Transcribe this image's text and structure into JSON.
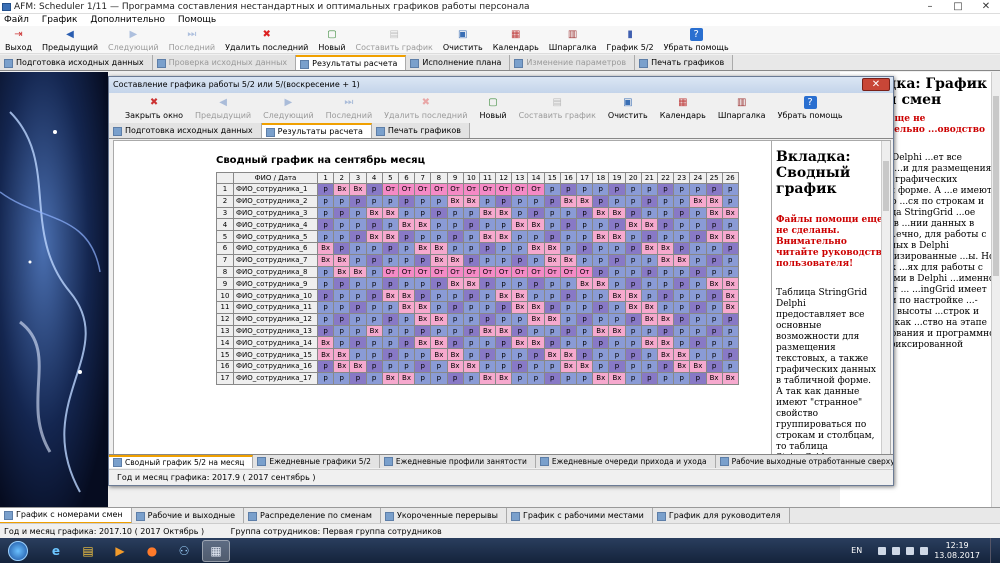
{
  "app": {
    "title": "AFM: Scheduler 1/11 — Программа составления  нестандартных и оптимальных графиков работы персонала",
    "win_controls": [
      "–",
      "□",
      "✕"
    ]
  },
  "menu": [
    "Файл",
    "График",
    "Дополнительно",
    "Помощь"
  ],
  "toolbar": [
    {
      "label": "Выход",
      "icon": "exit-icon",
      "enabled": true
    },
    {
      "label": "Предыдущий",
      "icon": "prev-icon",
      "enabled": true
    },
    {
      "label": "Следующий",
      "icon": "next-icon",
      "enabled": false
    },
    {
      "label": "Последний",
      "icon": "last-icon",
      "enabled": false
    },
    {
      "label": "Удалить последний",
      "icon": "delete-icon",
      "enabled": true
    },
    {
      "label": "Новый",
      "icon": "new-icon",
      "enabled": true
    },
    {
      "label": "Составить график",
      "icon": "compose-icon",
      "enabled": false
    },
    {
      "label": "Очистить",
      "icon": "clear-icon",
      "enabled": true
    },
    {
      "label": "Календарь",
      "icon": "calendar-icon",
      "enabled": true
    },
    {
      "label": "Шпаргалка",
      "icon": "cheatsheet-icon",
      "enabled": true
    },
    {
      "label": "График 5/2",
      "icon": "chart-icon",
      "enabled": true
    },
    {
      "label": "Убрать помощь",
      "icon": "help-icon",
      "enabled": true
    }
  ],
  "main_tabs": [
    {
      "label": "Подготовка исходных данных",
      "active": false,
      "enabled": true
    },
    {
      "label": "Проверка исходных данных",
      "active": false,
      "enabled": false
    },
    {
      "label": "Результаты расчета",
      "active": true,
      "enabled": true
    },
    {
      "label": "Исполнение плана",
      "active": false,
      "enabled": true
    },
    {
      "label": "Изменение параметров",
      "active": false,
      "enabled": false
    },
    {
      "label": "Печать графиков",
      "active": false,
      "enabled": true
    }
  ],
  "dialog": {
    "title": "Составление графика работы 5/2 или 5/(воскресение + 1)",
    "close": "✕",
    "toolbar": [
      {
        "label": "Закрыть окно",
        "icon": "close-window-icon",
        "enabled": true
      },
      {
        "label": "Предыдущий",
        "icon": "prev-icon",
        "enabled": false
      },
      {
        "label": "Следующий",
        "icon": "next-icon",
        "enabled": false
      },
      {
        "label": "Последний",
        "icon": "last-icon",
        "enabled": false
      },
      {
        "label": "Удалить последний",
        "icon": "delete-icon",
        "enabled": false
      },
      {
        "label": "Новый",
        "icon": "new-icon",
        "enabled": true
      },
      {
        "label": "Составить график",
        "icon": "compose-icon",
        "enabled": false
      },
      {
        "label": "Очистить",
        "icon": "clear-icon",
        "enabled": true
      },
      {
        "label": "Календарь",
        "icon": "calendar-icon",
        "enabled": true
      },
      {
        "label": "Шпаргалка",
        "icon": "cheatsheet-icon",
        "enabled": true
      },
      {
        "label": "Убрать помощь",
        "icon": "help-icon",
        "enabled": true
      }
    ],
    "tabs": [
      {
        "label": "Подготовка исходных данных",
        "active": false
      },
      {
        "label": "Результаты расчета",
        "active": true
      },
      {
        "label": "Печать графиков",
        "active": false
      }
    ],
    "heading": "Сводный график на сентябрь месяц",
    "grid_header_name": "ФИО / Дата",
    "days": [
      "1",
      "2",
      "3",
      "4",
      "5",
      "6",
      "7",
      "8",
      "9",
      "10",
      "11",
      "12",
      "13",
      "14",
      "15",
      "16",
      "17",
      "18",
      "19",
      "20",
      "21",
      "22",
      "23",
      "24",
      "25",
      "26"
    ],
    "rows": [
      {
        "n": "1",
        "name": "ФИО_сотрудника_1",
        "cells": "р Вх Вх р От От От От От От От От От От р р р р р р р р р р р р"
      },
      {
        "n": "2",
        "name": "ФИО_сотрудника_2",
        "cells": "р р р р р р р р Вх Вх р р р р р Вх Вх р р р р р р Вх Вх р"
      },
      {
        "n": "3",
        "name": "ФИО_сотрудника_3",
        "cells": "р р р Вх Вх р р р р р Вх Вх р р р р р Вх Вх р р р р р Вх Вх"
      },
      {
        "n": "4",
        "name": "ФИО_сотрудника_4",
        "cells": "р р р р р Вх Вх р р р р р Вх Вх р р р р р Вх Вх р р р р р"
      },
      {
        "n": "5",
        "name": "ФИО_сотрудника_5",
        "cells": "р р р Вх Вх р р р р р Вх Вх р р р р р Вх Вх р р р р р Вх Вх"
      },
      {
        "n": "6",
        "name": "ФИО_сотрудника_6",
        "cells": "Вх р р р р р Вх Вх р р р р р Вх Вх р р р р р Вх Вх р р р р"
      },
      {
        "n": "7",
        "name": "ФИО_сотрудника_7",
        "cells": "Вх Вх р р р р р Вх Вх р р р р р Вх Вх р р р р р Вх Вх р р р"
      },
      {
        "n": "8",
        "name": "ФИО_сотрудника_8",
        "cells": "р Вх Вх р От От От От От От От От От От От От От р р р р р р р р р"
      },
      {
        "n": "9",
        "name": "ФИО_сотрудника_9",
        "cells": "р р р р р р р р Вх Вх р р р р р р Вх Вх р р р р р р Вх Вх"
      },
      {
        "n": "10",
        "name": "ФИО_сотрудника_10",
        "cells": "р р р р Вх Вх р р р р р Вх Вх р р р р р Вх Вх р р р р р Вх"
      },
      {
        "n": "11",
        "name": "ФИО_сотрудника_11",
        "cells": "р р р р р Вх Вх р р р р р Вх Вх р р р р р Вх Вх р р р р Вх"
      },
      {
        "n": "12",
        "name": "ФИО_сотрудника_12",
        "cells": "р р р р р р Вх Вх р р р р р Вх Вх р р р р р Вх Вх р р р р"
      },
      {
        "n": "13",
        "name": "ФИО_сотрудника_13",
        "cells": "р р р Вх р р р р р р Вх Вх р р р р р Вх Вх р р р р р р р"
      },
      {
        "n": "14",
        "name": "ФИО_сотрудника_14",
        "cells": "Вх р р р р р Вх Вх р р р р Вх Вх р р р р р р Вх Вх р р р р"
      },
      {
        "n": "15",
        "name": "ФИО_сотрудника_15",
        "cells": "Вх Вх р р р р р Вх Вх р р р р р Вх Вх р р р р р Вх Вх р р р"
      },
      {
        "n": "16",
        "name": "ФИО_сотрудника_16",
        "cells": "р Вх Вх р р р р р Вх Вх р р р р р Вх Вх р р р р р Вх Вх р р"
      },
      {
        "n": "17",
        "name": "ФИО_сотрудника_17",
        "cells": "р р р р Вх Вх р р р р Вх Вх р р р р р Вх Вх р р р р р Вх Вх"
      }
    ],
    "help_heading": "Вкладка: Сводный график",
    "help_warning": "Файлы помощи еще не сделаны. Внимательно читайте руководство пользователя!",
    "help_body": "Таблица StringGrid Delphi предоставляет все основные возможности для размещения текстовых, а также графических данных в табличной форме. А так как данные имеют \"странное\" свойство группироваться по строкам и столбцам, то таблица StringGrid имеет важное значение",
    "bottom_tabs": [
      {
        "label": "Сводный график 5/2 на месяц",
        "active": true
      },
      {
        "label": "Ежедневные графики 5/2",
        "active": false
      },
      {
        "label": "Ежедневные профили занятости",
        "active": false
      },
      {
        "label": "Ежедневные очереди прихода и ухода",
        "active": false
      },
      {
        "label": "Рабочие выходные отработанные сверхурочные",
        "active": false
      }
    ],
    "status": "Год и месяц графика:  2017.9  ( 2017  сентябрь )"
  },
  "right_panel": {
    "heading": "Вкладка: График с ...ми смен",
    "warning": "...мощи еще не ...внимательно ...оводство ...ля!",
    "body": "...ingGrid Delphi ...ет все основные ...и для размещения ...а также графических ...бличной форме. А ...е имеют ...свойство ...ся по строкам и ...о таблица StringGrid ...ое значение в ...нии данных в системе ...ечно, для работы с ...баз данных в Delphi ...специализированные ...ы. Но в обычных ...ях для работы с ...и данными в Delphi ...именно компонент ... ...ingGrid имеет гибкие ...и по настройке ...- ширины и высоты ...строк и столбцов, как ...ство на этапе проектирования и программно, размера фиксированной области"
  },
  "main_bottom_tabs": [
    {
      "label": "График с номерами смен",
      "active": true
    },
    {
      "label": "Рабочие и выходные",
      "active": false
    },
    {
      "label": "Распределение по сменам",
      "active": false
    },
    {
      "label": "Укороченные перерывы",
      "active": false
    },
    {
      "label": "График с рабочими местами",
      "active": false
    },
    {
      "label": "График для руководителя",
      "active": false
    }
  ],
  "status": {
    "month": "Год и месяц графика:  2017.10   ( 2017  Октябрь )",
    "group": "Группа сотрудников:   Первая группа сотрудников"
  },
  "taskbar": {
    "lang": "EN",
    "time": "12:19",
    "date": "13.08.2017"
  },
  "colors": {
    "work": "#8a9bd6",
    "work_dark": "#8879c6",
    "dayoff": "#f6a9ce",
    "vacation": "#f58ac6",
    "accent": "#f0a000"
  }
}
